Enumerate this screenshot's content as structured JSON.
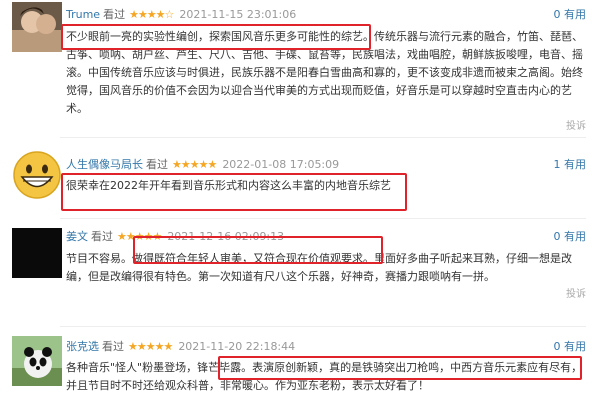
{
  "reviews": [
    {
      "user": "Trume",
      "watched": "看过",
      "stars": "★★★★☆",
      "date": "2021-11-15 23:01:06",
      "useful": "0 有用",
      "body": "不少眼前一亮的实验性编创，探索国风音乐更多可能性的综艺。传统乐器与流行元素的融合，竹笛、琵琶、古筝、唢呐、胡户丝、芦生、尺八、吉他、手碟、鼠苔等，民族唱法，戏曲唱腔，朝鲜族扳唆哩，电音、摇滚。中国传统音乐应该与时俱进，民族乐器不是阳春白雪曲高和寡的，更不该变成非遗而被束之高阁。始终觉得，国风音乐的价值不会因为以迎合当代审美的方式出现而贬值，好音乐是可以穿越时空直击内心的艺术。",
      "report": "投诉",
      "avatar": "photo-avatar"
    },
    {
      "user": "人生偶像马局长",
      "watched": "看过",
      "stars": "★★★★★",
      "date": "2022-01-08 17:05:09",
      "useful": "1 有用",
      "body": "很荣幸在2022年开年看到音乐形式和内容这么丰富的内地音乐综艺",
      "report": "",
      "avatar": "emoji-avatar"
    },
    {
      "user": "姜文",
      "watched": "看过",
      "stars": "★★★★★",
      "date": "2021-12-16 02:09:13",
      "useful": "0 有用",
      "body": "节目不容易。做得既符合年轻人审美，又符合现在价值观要求。里面好多曲子听起来耳熟，仔细一想是改编，但是改编得很有特色。第一次知道有尺八这个乐器，好神奇，赛播力跟唢呐有一拼。",
      "report": "投诉",
      "avatar": "black-avatar"
    },
    {
      "user": "张克选",
      "watched": "看过",
      "stars": "★★★★★",
      "date": "2021-11-20 22:18:44",
      "useful": "0 有用",
      "body": "各种音乐\"怪人\"粉墨登场，锋芒毕露。表演原创新颖，真的是铁骑突出刀枪鸣，中西方音乐元素应有尽有，并且节目时不时还给观众科普，非常暖心。作为亚东老粉，表示太好看了！",
      "report": "",
      "avatar": "panda-avatar"
    }
  ]
}
